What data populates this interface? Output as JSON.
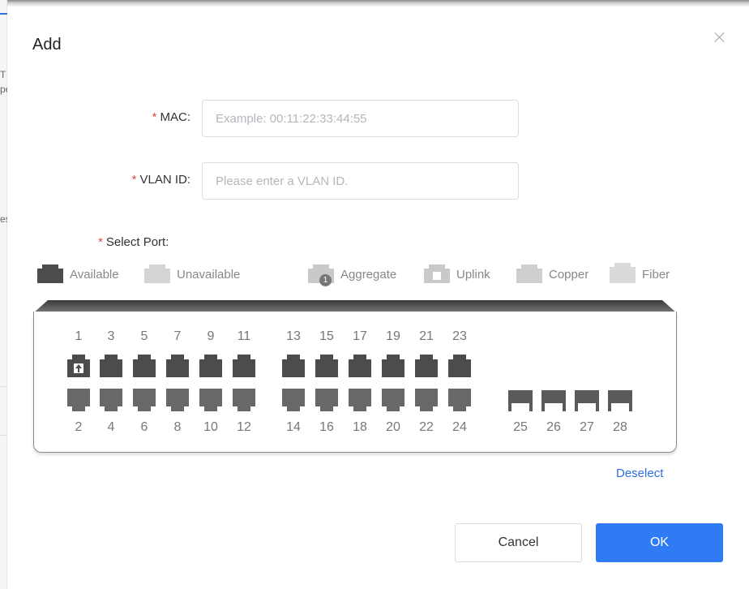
{
  "background": {
    "left_fragments": [
      "T",
      "pe",
      "es"
    ]
  },
  "dialog": {
    "title": "Add",
    "mac": {
      "label": "MAC:",
      "placeholder": "Example: 00:11:22:33:44:55",
      "value": ""
    },
    "vlan": {
      "label": "VLAN ID:",
      "placeholder": "Please enter a VLAN ID.",
      "value": ""
    },
    "select_port": {
      "label": "Select Port:"
    },
    "required_mark": "*",
    "legend": [
      {
        "key": "available",
        "label": "Available",
        "color": "#4c4c4c"
      },
      {
        "key": "unavailable",
        "label": "Unavailable",
        "color": "#d4d4d4"
      },
      {
        "key": "aggregate",
        "label": "Aggregate",
        "color": "#c9c9c9",
        "badge": "1"
      },
      {
        "key": "uplink",
        "label": "Uplink",
        "color": "#c9c9c9"
      },
      {
        "key": "copper",
        "label": "Copper",
        "color": "#cfcfcf"
      },
      {
        "key": "fiber",
        "label": "Fiber",
        "color": "#d9d9d9"
      }
    ],
    "ports": {
      "top_row": [
        "1",
        "3",
        "5",
        "7",
        "9",
        "11",
        "13",
        "15",
        "17",
        "19",
        "21",
        "23"
      ],
      "bottom_row": [
        "2",
        "4",
        "6",
        "8",
        "10",
        "12",
        "14",
        "16",
        "18",
        "20",
        "22",
        "24"
      ],
      "fiber": [
        "25",
        "26",
        "27",
        "28"
      ],
      "uplink_port": "1"
    },
    "deselect_label": "Deselect",
    "buttons": {
      "cancel": "Cancel",
      "ok": "OK"
    }
  }
}
